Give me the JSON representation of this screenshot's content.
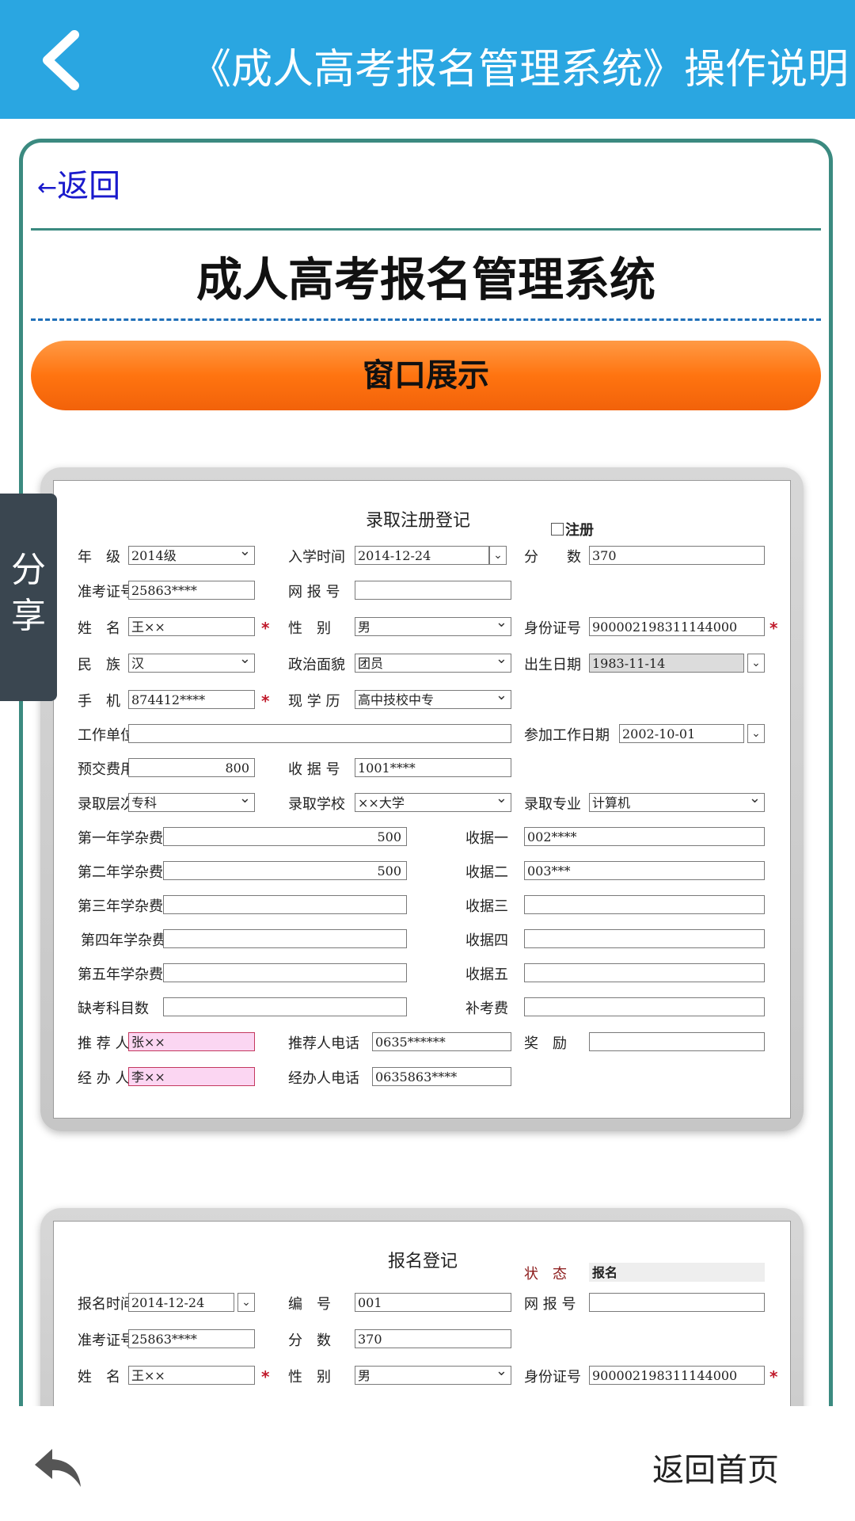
{
  "header": {
    "title": "《成人高考报名管理系统》操作说明",
    "back_icon": "chevron-left-icon"
  },
  "article": {
    "return_arrow": "←",
    "return_label": "返回",
    "title": "成人高考报名管理系统",
    "section_banner": "窗口展示"
  },
  "form1": {
    "title": "录取注册登记",
    "register_label": "注册",
    "grade_label": "年　级",
    "grade": "2014级",
    "enroll_time_label": "入学时间",
    "enroll_time": "2014-12-24",
    "score_label": "分　　数",
    "score": "370",
    "exam_no_label": "准考证号",
    "exam_no": "25863****",
    "net_no_label": "网 报 号",
    "net_no": "",
    "name_label": "姓　名",
    "name": "王××",
    "gender_label": "性　别",
    "gender": "男",
    "id_label": "身份证号",
    "id": "900002198311144000",
    "ethnic_label": "民　族",
    "ethnic": "汉",
    "politics_label": "政治面貌",
    "politics": "团员",
    "birth_label": "出生日期",
    "birth": "1983-11-14",
    "phone_label": "手　机",
    "phone": "874412****",
    "edu_label": "现 学 历",
    "edu": "高中技校中专",
    "work_unit_label": "工作单位",
    "work_unit": "",
    "work_date_label": "参加工作日期",
    "work_date": "2002-10-01",
    "prepay_label": "预交费用",
    "prepay": "800",
    "receipt_label": "收 据 号",
    "receipt": "1001****",
    "level_label": "录取层次",
    "level": "专科",
    "school_label": "录取学校",
    "school": "××大学",
    "major_label": "录取专业",
    "major": "计算机",
    "fee1_label": "第一年学杂费",
    "fee1": "500",
    "rcpt1_label": "收据一",
    "rcpt1": "002****",
    "fee2_label": "第二年学杂费",
    "fee2": "500",
    "rcpt2_label": "收据二",
    "rcpt2": "003***",
    "fee3_label": "第三年学杂费",
    "fee3": "",
    "rcpt3_label": "收据三",
    "rcpt3": "",
    "fee4_label": "第四年学杂费",
    "fee4": "",
    "rcpt4_label": "收据四",
    "rcpt4": "",
    "fee5_label": "第五年学杂费",
    "fee5": "",
    "rcpt5_label": "收据五",
    "rcpt5": "",
    "missing_label": "缺考科目数",
    "missing": "",
    "makeup_label": "补考费",
    "makeup": "",
    "referrer_label": "推 荐 人",
    "referrer": "张××",
    "referrer_phone_label": "推荐人电话",
    "referrer_phone": "0635******",
    "reward_label": "奖　励",
    "reward": "",
    "handler_label": "经 办 人",
    "handler": "李××",
    "handler_phone_label": "经办人电话",
    "handler_phone": "0635863****"
  },
  "form2": {
    "title": "报名登记",
    "status_label": "状　态",
    "status": "报名",
    "reg_time_label": "报名时间",
    "reg_time": "2014-12-24",
    "number_label": "编　号",
    "number": "001",
    "net_no_label": "网 报 号",
    "net_no": "",
    "exam_no_label": "准考证号",
    "exam_no": "25863****",
    "score_label": "分　数",
    "score": "370",
    "name_label": "姓　名",
    "name": "王××",
    "gender_label": "性　别",
    "gender": "男",
    "id_label": "身份证号",
    "id": "900002198311144000"
  },
  "share": {
    "chars": [
      "分",
      "享"
    ]
  },
  "footer": {
    "home_label": "返回首页",
    "reply_icon": "reply-arrow-icon"
  },
  "colors": {
    "header_bg": "#2aa6e1",
    "card_border": "#3b8a80",
    "banner": "#ff7410",
    "link": "#1a1acc"
  }
}
